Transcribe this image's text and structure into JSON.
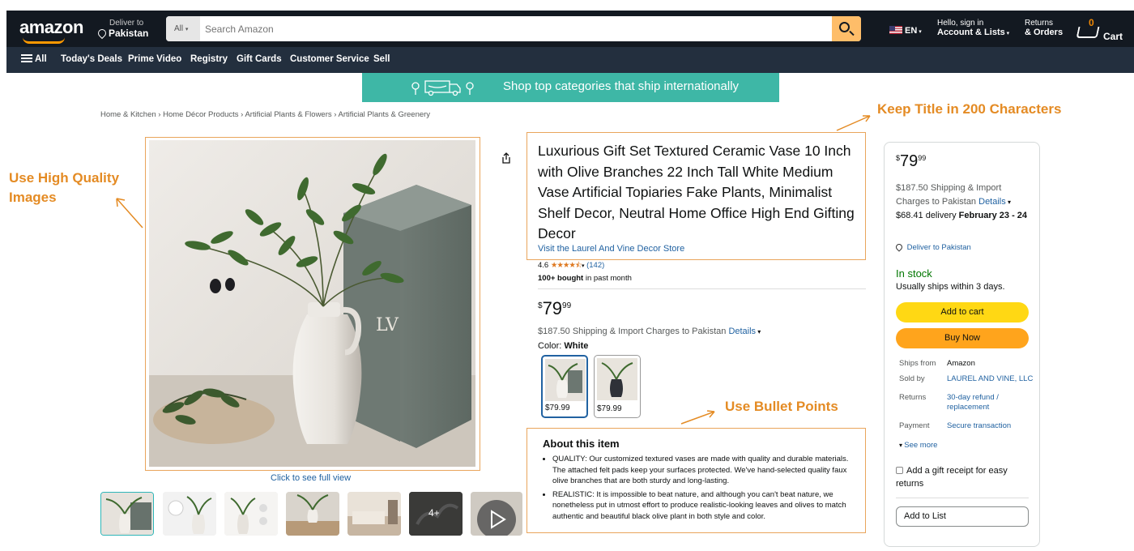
{
  "header": {
    "logo": "amazon",
    "deliver_line1": "Deliver to",
    "deliver_line2": "Pakistan",
    "search_category": "All",
    "search_placeholder": "Search Amazon",
    "language": "EN",
    "account_line1": "Hello, sign in",
    "account_line2": "Account & Lists",
    "orders_line1": "Returns",
    "orders_line2": "& Orders",
    "cart_count": "0",
    "cart_label": "Cart"
  },
  "subnav": {
    "all": "All",
    "items": [
      "Today's Deals",
      "Prime Video",
      "Registry",
      "Gift Cards",
      "Customer Service",
      "Sell"
    ]
  },
  "banner": {
    "text": "Shop top categories that ship internationally"
  },
  "breadcrumb": "Home & Kitchen › Home Décor Products › Artificial Plants & Flowers › Artificial Plants & Greenery",
  "annotations": {
    "images": "Use High Quality Images",
    "title": "Keep Title in 200 Characters",
    "bullets": "Use Bullet Points"
  },
  "gallery": {
    "full_view": "Click to see full view",
    "more_count": "4+"
  },
  "product": {
    "title": "Luxurious Gift Set Textured Ceramic Vase 10 Inch with Olive Branches 22 Inch Tall White Medium Vase Artificial Topiaries Fake Plants, Minimalist Shelf Decor, Neutral Home Office High End Gifting Decor",
    "store": "Visit the Laurel And Vine Decor Store",
    "rating": "4.6",
    "stars_value": 4.6,
    "reviews": "(142)",
    "bought_bold": "100+ bought",
    "bought_rest": "in past month",
    "price_symbol": "$",
    "price_whole": "79",
    "price_cents": "99",
    "shipping": "$187.50 Shipping & Import Charges to Pakistan",
    "details": "Details",
    "color_label": "Color:",
    "color_value": "White",
    "swatches": [
      {
        "price": "$79.99",
        "selected": true
      },
      {
        "price": "$79.99",
        "selected": false
      }
    ]
  },
  "about": {
    "heading": "About this item",
    "bullets": [
      "QUALITY: Our customized textured vases are made with quality and durable materials. The attached felt pads keep your surfaces protected. We've hand-selected quality faux olive branches that are both sturdy and long-lasting.",
      "REALISTIC: It is impossible to beat nature, and although you can't beat nature, we nonetheless put in utmost effort to produce realistic-looking leaves and olives to match authentic and beautiful black olive plant in both style and color."
    ]
  },
  "buybox": {
    "price_symbol": "$",
    "price_whole": "79",
    "price_cents": "99",
    "shipping": "$187.50 Shipping & Import Charges to Pakistan",
    "details": "Details",
    "delivery_prefix": "$68.41 delivery",
    "delivery_date": "February 23 - 24",
    "deliver_to": "Deliver to Pakistan",
    "stock": "In stock",
    "ships_within": "Usually ships within 3 days.",
    "add_to_cart": "Add to cart",
    "buy_now": "Buy Now",
    "ships_from_label": "Ships from",
    "ships_from_value": "Amazon",
    "sold_by_label": "Sold by",
    "sold_by_value": "LAUREL AND VINE, LLC",
    "returns_label": "Returns",
    "returns_value": "30-day refund / replacement",
    "payment_label": "Payment",
    "payment_value": "Secure transaction",
    "see_more": "See more",
    "gift_receipt": "Add a gift receipt for easy returns",
    "add_to_list": "Add to List"
  },
  "colors": {
    "nav_dark": "#131921",
    "nav_sub": "#232f3e",
    "search_button": "#febd69",
    "banner": "#3eb7a6",
    "annotation": "#e48b24",
    "add_to_cart": "#ffd814",
    "buy_now": "#ffa41c",
    "in_stock": "#007600",
    "link": "#2162a1"
  }
}
